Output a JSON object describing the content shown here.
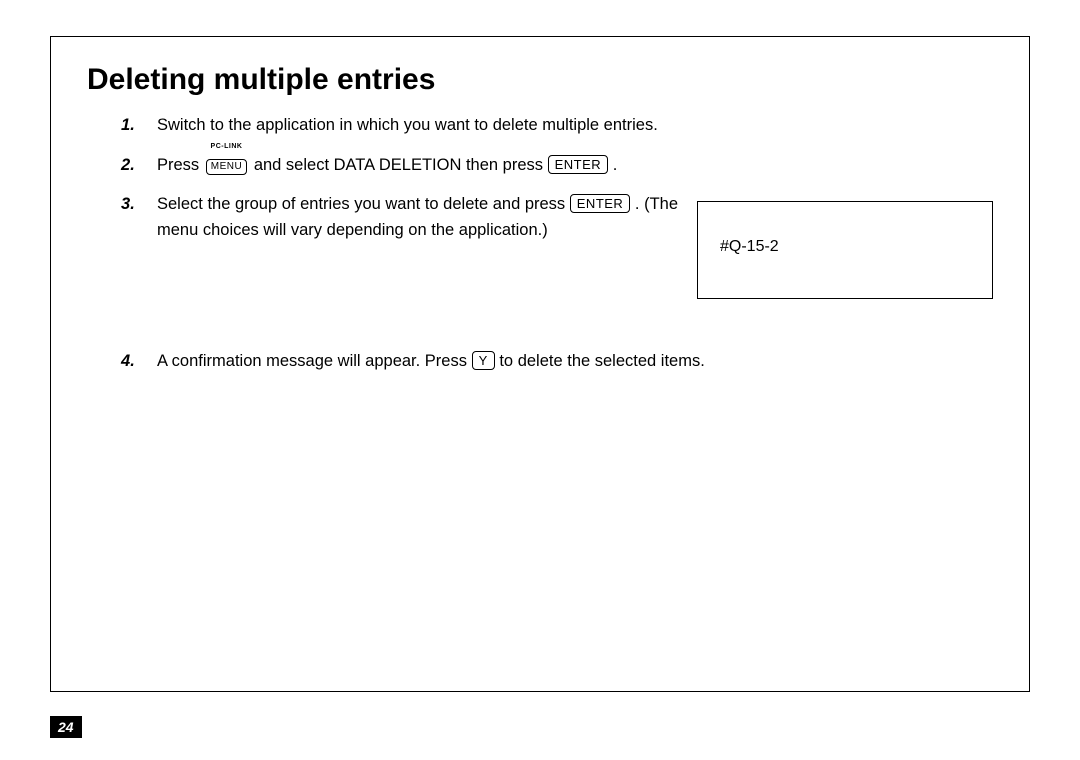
{
  "page_number": "24",
  "heading": "Deleting multiple entries",
  "callout": "#Q-15-2",
  "keys": {
    "menu": "MENU",
    "menu_super": "PC-LINK",
    "enter": "ENTER",
    "y": "Y"
  },
  "steps": {
    "s1": "Switch to the application in which you want to delete multiple entries.",
    "s2a": "Press ",
    "s2b": " and select DATA DELETION then press ",
    "s2c": " .",
    "s3a": "Select the group of entries you want to delete and press ",
    "s3b": " . (The menu choices will vary depending on the application.)",
    "s4a": "A confirmation message will appear. Press ",
    "s4b": " to delete the selected items."
  }
}
